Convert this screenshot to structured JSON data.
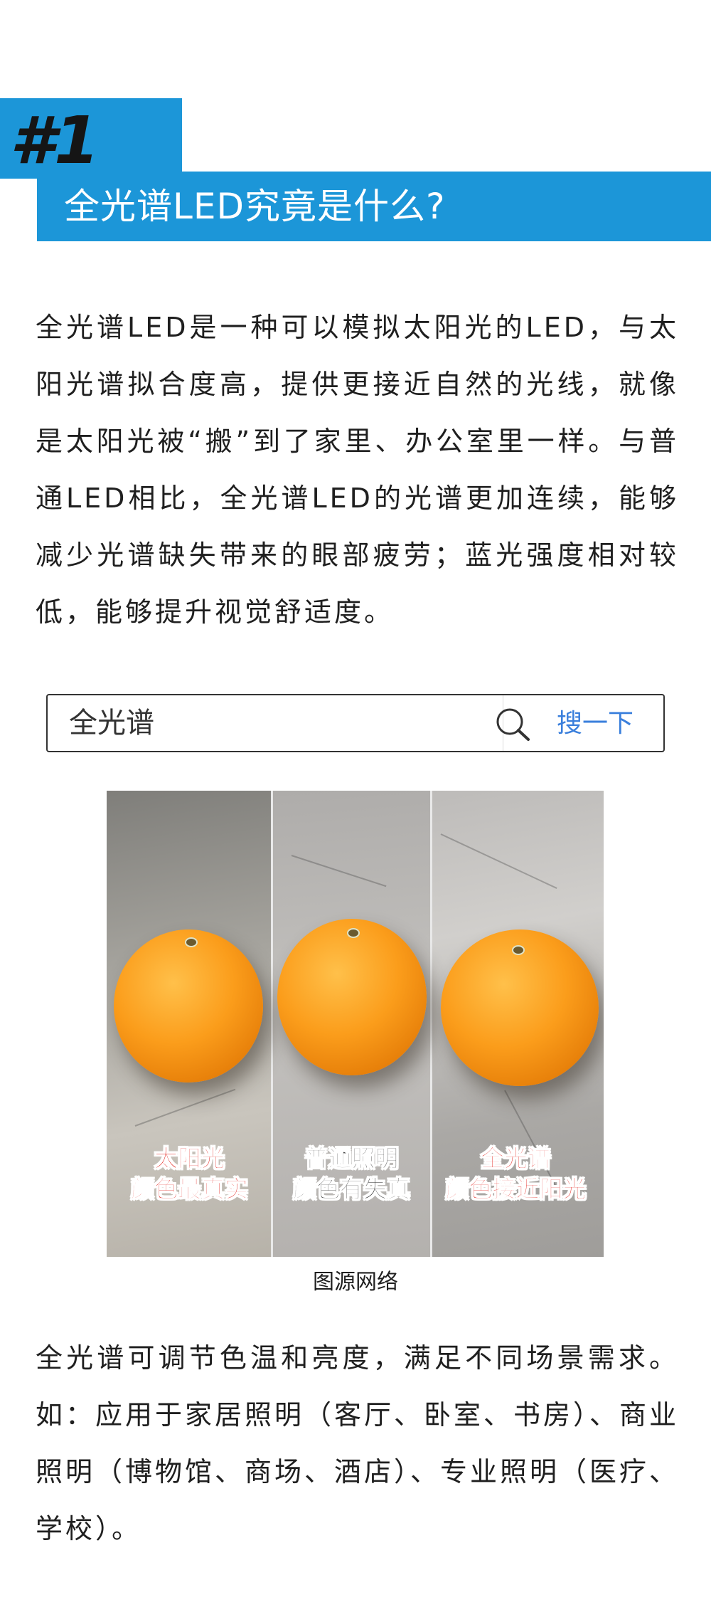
{
  "section": {
    "number": "#1",
    "title": "全光谱LED究竟是什么?"
  },
  "intro": "全光谱LED是一种可以模拟太阳光的LED，与太阳光谱拟合度高，提供更接近自然的光线，就像是太阳光被“搬”到了家里、办公室里一样。与普通LED相比，全光谱LED的光谱更加连续，能够减少光谱缺失带来的眼部疲劳；蓝光强度相对较低，能够提升视觉舒适度。",
  "search": {
    "query": "全光谱",
    "button_label": "搜一下",
    "icon": "search-icon"
  },
  "image": {
    "panels": [
      {
        "line1": "太阳光",
        "line2": "颜色最真实"
      },
      {
        "line1": "普通照明",
        "line2": "颜色有失真"
      },
      {
        "line1": "全光谱",
        "line2": "颜色接近阳光"
      }
    ],
    "caption": "图源网络"
  },
  "body2": "全光谱可调节色温和亮度，满足不同场景需求。如：应用于家居照明（客厅、卧室、书房）、商业照明（博物馆、商场、酒店）、专业照明（医疗、学校）。",
  "colors": {
    "accent": "#1c96d8",
    "caption_red": "#e21b14",
    "search_button": "#3a7fdc"
  }
}
